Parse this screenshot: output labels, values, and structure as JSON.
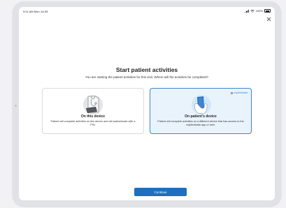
{
  "status_bar": {
    "time": "9:41 AM  Mon Jul 05",
    "battery": "100%"
  },
  "header": {
    "close_icon": "close-icon"
  },
  "main": {
    "title": "Start patient activities",
    "subtitle": "You are starting the patient activities for this visit. Where will the activities be completed?"
  },
  "options": [
    {
      "title": "On this device",
      "description": "Patient will complete activities on this device and will authenticate with a PIN.",
      "icon": "doctor-tablet-illustration",
      "selected": false
    },
    {
      "title": "On patient's device",
      "description": "Patient will complete activities on a different device that has access to the myMedidata app or web.",
      "icon": "hand-phone-illustration",
      "brand_label": "myMedidata",
      "selected": true
    }
  ],
  "footer": {
    "continue_label": "Continue"
  },
  "colors": {
    "accent": "#1e6fc0",
    "selected_bg": "#e9f3fc",
    "selected_border": "#3f86d0"
  }
}
